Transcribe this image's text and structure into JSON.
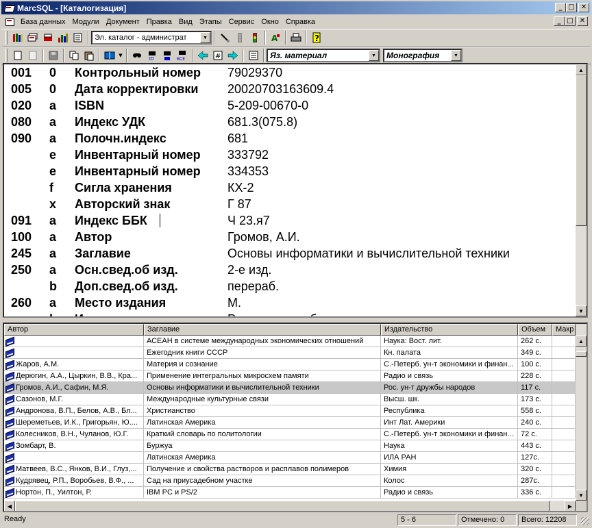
{
  "window": {
    "title": "MarcSQL - [Каталогизация]",
    "btn_minimize": "_",
    "btn_maximize": "□",
    "btn_close": "✕"
  },
  "menu": [
    "База данных",
    "Модули",
    "Документ",
    "Правка",
    "Вид",
    "Этапы",
    "Сервис",
    "Окно",
    "Справка"
  ],
  "toolbar": {
    "catalog_combo": "Эл. каталог - администрат",
    "language_combo": "Яз. материал",
    "type_combo": "Монография"
  },
  "record": [
    {
      "tag": "001",
      "sub": "0",
      "label": "Контрольный номер",
      "value": "79029370"
    },
    {
      "tag": "005",
      "sub": "0",
      "label": "Дата корректировки",
      "value": "20020703163609.4"
    },
    {
      "tag": "020",
      "sub": "a",
      "label": "ISBN",
      "value": "5-209-00670-0"
    },
    {
      "tag": "080",
      "sub": "a",
      "label": "Индекс УДК",
      "value": "681.3(075.8)"
    },
    {
      "tag": "090",
      "sub": "a",
      "label": "Полочн.индекс",
      "value": "681"
    },
    {
      "tag": "",
      "sub": "e",
      "label": "Инвентарный номер",
      "value": "333792"
    },
    {
      "tag": "",
      "sub": "e",
      "label": "Инвентарный номер",
      "value": "334353"
    },
    {
      "tag": "",
      "sub": "f",
      "label": "Сигла хранения",
      "value": "КХ-2"
    },
    {
      "tag": "",
      "sub": "x",
      "label": "Авторский знак",
      "value": "Г 87"
    },
    {
      "tag": "091",
      "sub": "a",
      "label": "Индекс ББК",
      "value": "Ч 23.я7"
    },
    {
      "tag": "100",
      "sub": "a",
      "label": "Автор",
      "value": "Громов, А.И."
    },
    {
      "tag": "245",
      "sub": "a",
      "label": "Заглавие",
      "value": "Основы информатики и вычислительной техники"
    },
    {
      "tag": "250",
      "sub": "a",
      "label": "Осн.свед.об изд.",
      "value": "2-е изд."
    },
    {
      "tag": "",
      "sub": "b",
      "label": "Доп.свед.об изд.",
      "value": "перераб."
    },
    {
      "tag": "260",
      "sub": "a",
      "label": "Место издания",
      "value": "М."
    },
    {
      "tag": "",
      "sub": "b",
      "label": "Издательство",
      "value": "Рос. ун-т дружбы народов"
    }
  ],
  "grid": {
    "columns": [
      "Автор",
      "Заглавие",
      "Издательство",
      "Объем",
      "Макр"
    ],
    "rows": [
      {
        "author": "",
        "title": "АСЕАН в системе международных экономических отношений",
        "publisher": "Наука: Вост. лит.",
        "volume": "262 с."
      },
      {
        "author": "",
        "title": "Ежегодник книги СССР",
        "publisher": "Кн. палата",
        "volume": "349 с."
      },
      {
        "author": "Жаров, А.М.",
        "title": "Материя и сознание",
        "publisher": "С.-Петерб. ун-т экономики и финан...",
        "volume": "100 с."
      },
      {
        "author": "Дерюгин, А.А., Цыркин, В.В., Кра...",
        "title": "Применение интегральных микросхем памяти",
        "publisher": "Радио и связь",
        "volume": "228 с."
      },
      {
        "author": "Громов, А.И., Сафин, М.Я.",
        "title": "Основы информатики и вычислительной техники",
        "publisher": "Рос. ун-т дружбы народов",
        "volume": "117 с."
      },
      {
        "author": "Сазонов, М.Г.",
        "title": "Международные культурные связи",
        "publisher": "Высш. шк.",
        "volume": "173 с."
      },
      {
        "author": "Андронова, В.П., Белов, А.В., Бл...",
        "title": "Христианство",
        "publisher": "Республика",
        "volume": "558 с."
      },
      {
        "author": "Шереметьев, И.К., Григорьян, Ю....",
        "title": "Латинская Америка",
        "publisher": "Инт Лат. Америки",
        "volume": "240 с."
      },
      {
        "author": "Колесников, В.Н., Чуланов, Ю.Г.",
        "title": "Краткий словарь по политологии",
        "publisher": "С.-Петерб. ун-т экономики и финан...",
        "volume": "72 с."
      },
      {
        "author": "Зомбарт, В.",
        "title": "Буржуа",
        "publisher": "Наука",
        "volume": "443 с."
      },
      {
        "author": "",
        "title": "Латинская Америка",
        "publisher": "ИЛА РАН",
        "volume": "127с."
      },
      {
        "author": "Матвеев, В.С., Янков, В.И., Глуз,...",
        "title": "Получение и свойства растворов и расплавов полимеров",
        "publisher": "Химия",
        "volume": "320 с."
      },
      {
        "author": "Кудрявец, Р.П., Воробьев, В.Ф., ...",
        "title": "Сад на приусадебном участке",
        "publisher": "Колос",
        "volume": "287с."
      },
      {
        "author": "Нортон, П., Уилтон, Р.",
        "title": "IBM PC и PS/2",
        "publisher": "Радио и связь",
        "volume": "336 с."
      }
    ],
    "selected_index": 4
  },
  "status": {
    "ready": "Ready",
    "position": "5 - 6",
    "marked": "Отмечено: 0",
    "total": "Всего: 12208"
  },
  "colors": {
    "title_start": "#0a246a",
    "title_end": "#a6caf0",
    "face": "#d4d0c8",
    "selection": "#c8c8c8"
  }
}
